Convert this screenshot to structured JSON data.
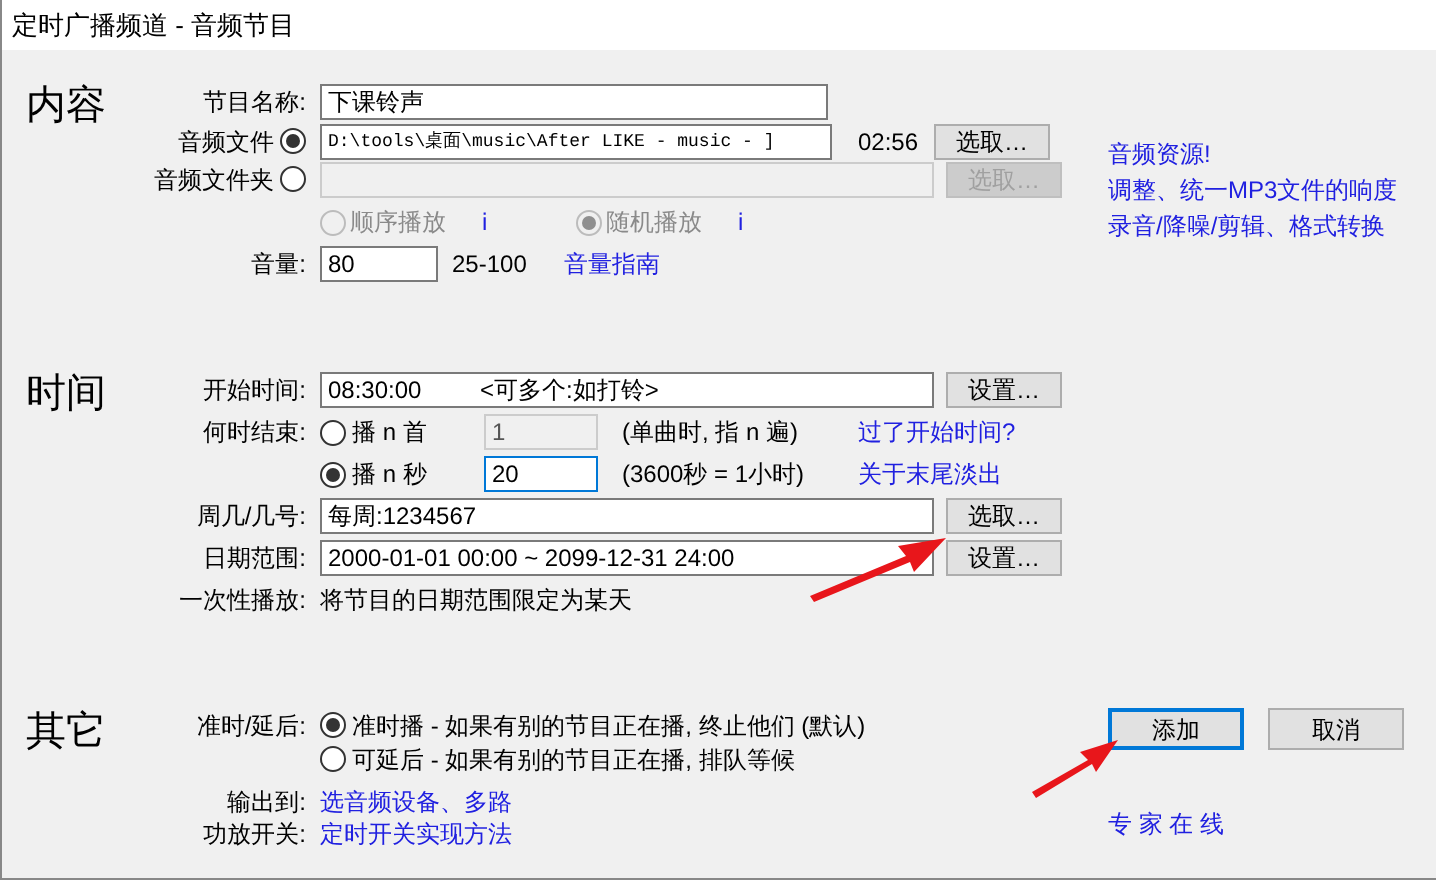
{
  "window": {
    "title": "定时广播频道 - 音频节目"
  },
  "content": {
    "heading": "内容",
    "name": {
      "label": "节目名称:",
      "value": "下课铃声"
    },
    "sources": [
      {
        "label": "音频文件",
        "selected": true,
        "value": "D:\\tools\\桌面\\music\\After LIKE - music - ]",
        "duration": "02:56",
        "button": "选取…",
        "disabled": false
      },
      {
        "label": "音频文件夹",
        "selected": false,
        "button": "选取…",
        "disabled": true
      }
    ],
    "play_order": [
      {
        "label": "顺序播放",
        "selected": false,
        "disabled": true,
        "info": "i"
      },
      {
        "label": "随机播放",
        "selected": true,
        "disabled": true,
        "info": "i"
      }
    ],
    "volume": {
      "label": "音量:",
      "value": "80",
      "range": "25-100",
      "link": "音量指南"
    },
    "links": [
      "音频资源!",
      "调整、统一MP3文件的响度",
      "录音/降噪/剪辑、格式转换"
    ]
  },
  "time": {
    "heading": "时间",
    "start": {
      "label": "开始时间:",
      "value": "08:30:00",
      "hint": "<可多个:如打铃>",
      "button": "设置…"
    },
    "end": {
      "label": "何时结束:",
      "options": [
        {
          "label": "播 n 首",
          "selected": false,
          "value": "1",
          "note": "(单曲时, 指 n 遍)",
          "link": "过了开始时间?"
        },
        {
          "label": "播 n 秒",
          "selected": true,
          "value": "20",
          "note": "(3600秒 = 1小时)",
          "link": "关于末尾淡出"
        }
      ]
    },
    "weekdays": {
      "label": "周几/几号:",
      "value": "每周:1234567",
      "button": "选取…"
    },
    "date_range": {
      "label": "日期范围:",
      "value": "2000-01-01 00:00 ~ 2099-12-31 24:00",
      "button": "设置…"
    },
    "one_time": {
      "label": "一次性播放:",
      "text": "将节目的日期范围限定为某天"
    }
  },
  "other": {
    "heading": "其它",
    "timing": {
      "label": "准时/延后:",
      "options": [
        {
          "label": "准时播 - 如果有别的节目正在播, 终止他们 (默认)",
          "selected": true
        },
        {
          "label": "可延后 - 如果有别的节目正在播, 排队等候",
          "selected": false
        }
      ]
    },
    "output": {
      "label": "输出到:",
      "link": "选音频设备、多路"
    },
    "amp": {
      "label": "功放开关:",
      "link": "定时开关实现方法"
    }
  },
  "buttons": [
    {
      "label": "添加",
      "default": true
    },
    {
      "label": "取消",
      "default": false
    }
  ],
  "expert_link": "专 家 在 线"
}
